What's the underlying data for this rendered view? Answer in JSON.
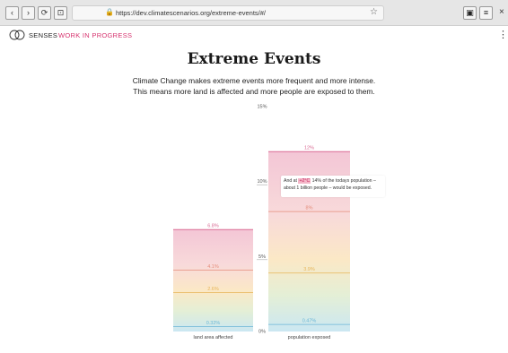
{
  "browser": {
    "url": "https://dev.climatescenarios.org/extreme-events/#/",
    "back_label": "‹",
    "forward_label": "›",
    "reload_label": "⟳",
    "home_label": "⊡",
    "lock_label": "🔒",
    "star_label": "☆",
    "save_label": "▣",
    "menu_label": "≡",
    "close_label": "×",
    "icons": [
      "back-icon",
      "forward-icon",
      "reload-icon",
      "home-icon",
      "lock-icon",
      "star-icon",
      "save-icon",
      "menu-icon",
      "close-icon"
    ]
  },
  "site": {
    "brand": "SENSES",
    "status": "WORK IN PROGRESS",
    "kebab_label": "⋮",
    "accent_color": "#d6326e"
  },
  "page": {
    "title": "Extreme Events",
    "subtitle_line1": "Climate Change makes extreme events more frequent and more intense.",
    "subtitle_line2": "This means more land is affected and more people are exposed to them."
  },
  "tooltip": {
    "text_before": "And at ",
    "highlight": "+2°C",
    "text_after": " 14% of the todays population –",
    "line2": "about 1 billion people – would be exposed."
  },
  "chart_data": {
    "type": "bar",
    "ylim": [
      0,
      15
    ],
    "y_ticks": [
      {
        "value": 0,
        "label": "0%"
      },
      {
        "value": 5,
        "label": "5%"
      },
      {
        "value": 10,
        "label": "10%"
      },
      {
        "value": 15,
        "label": "15%"
      }
    ],
    "categories": [
      {
        "name": "land area affected",
        "top": 6.8,
        "levels": [
          {
            "value": 6.8,
            "label": "6.8%",
            "color": "#d96a93"
          },
          {
            "value": 4.1,
            "label": "4.1%",
            "color": "#e58d7b"
          },
          {
            "value": 2.6,
            "label": "2.6%",
            "color": "#e7b55a"
          },
          {
            "value": 0.32,
            "label": "0.32%",
            "color": "#6ab6d8"
          }
        ]
      },
      {
        "name": "population exposed",
        "top": 12,
        "levels": [
          {
            "value": 12,
            "label": "12%",
            "color": "#d96a93"
          },
          {
            "value": 8,
            "label": "8%",
            "color": "#e58d7b"
          },
          {
            "value": 3.9,
            "label": "3.9%",
            "color": "#e7b55a"
          },
          {
            "value": 0.47,
            "label": "0.47%",
            "color": "#6ab6d8"
          }
        ]
      }
    ]
  }
}
